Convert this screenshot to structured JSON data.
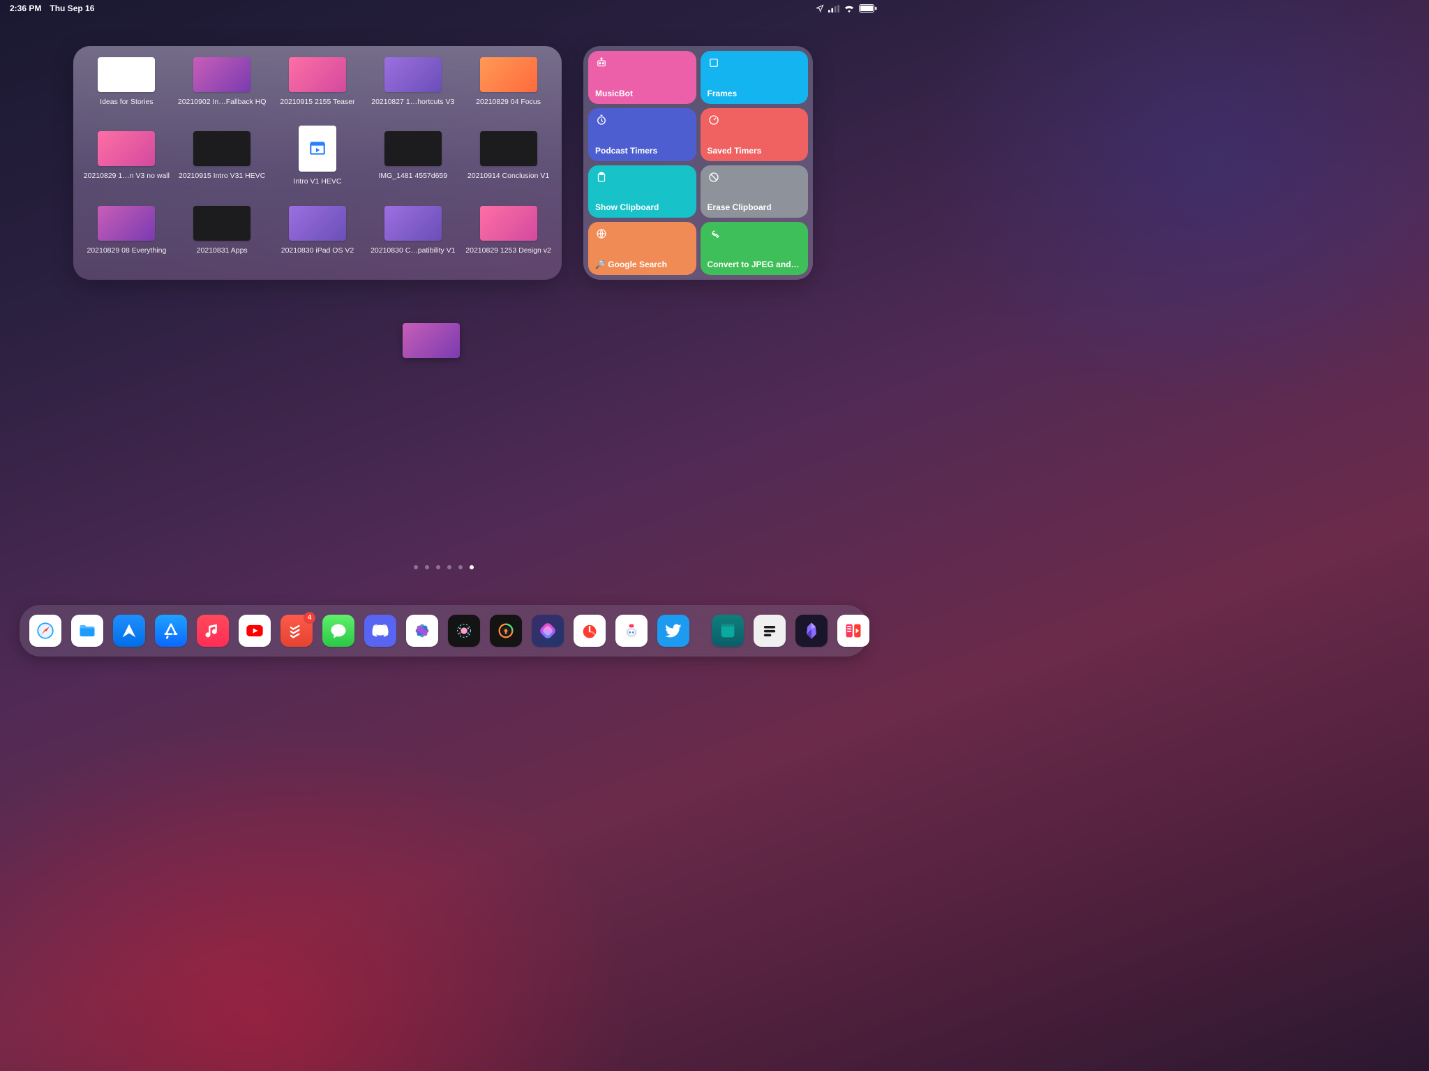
{
  "status": {
    "time": "2:36 PM",
    "date": "Thu Sep 16"
  },
  "files": [
    {
      "label": "Ideas for Stories",
      "theme": "ft-white"
    },
    {
      "label": "20210902 In…Fallback HQ",
      "theme": "ft-brand"
    },
    {
      "label": "20210915 2155 Teaser",
      "theme": "ft-pink"
    },
    {
      "label": "20210827 1…hortcuts V3",
      "theme": "ft-purple"
    },
    {
      "label": "20210829 04 Focus",
      "theme": "ft-amber"
    },
    {
      "label": "20210829 1…n V3 no wall",
      "theme": "ft-pink"
    },
    {
      "label": "20210915 Intro V31 HEVC",
      "theme": "ft-dark"
    },
    {
      "label": "Intro V1 HEVC",
      "theme": "ft-doc"
    },
    {
      "label": "IMG_1481 4557d659",
      "theme": "ft-dark"
    },
    {
      "label": "20210914 Conclusion V1",
      "theme": "ft-dark"
    },
    {
      "label": "20210829 08 Everything",
      "theme": "ft-brand"
    },
    {
      "label": "20210831 Apps",
      "theme": "ft-dark"
    },
    {
      "label": "20210830 iPad OS V2",
      "theme": "ft-purple"
    },
    {
      "label": "20210830 C…patibility V1",
      "theme": "ft-purple"
    },
    {
      "label": "20210829 1253 Design v2",
      "theme": "ft-pink"
    }
  ],
  "shortcuts": [
    {
      "label": "MusicBot",
      "icon": "robot",
      "color": "#ec5fa9"
    },
    {
      "label": "Frames",
      "icon": "square",
      "color": "#14b4f0"
    },
    {
      "label": "Podcast Timers",
      "icon": "clock",
      "color": "#4d5fd0"
    },
    {
      "label": "Saved Timers",
      "icon": "gauge",
      "color": "#f06262"
    },
    {
      "label": "Show Clipboard",
      "icon": "clipboard",
      "color": "#17c2c8"
    },
    {
      "label": "Erase Clipboard",
      "icon": "nope",
      "color": "#8e939b"
    },
    {
      "label": "🔎 Google Search",
      "icon": "globe",
      "color": "#f08b55"
    },
    {
      "label": "Convert to JPEG and C…",
      "icon": "wrench",
      "color": "#3fbf59"
    }
  ],
  "pagination": {
    "count": 6,
    "active": 5
  },
  "dock": {
    "pinned": [
      {
        "name": "safari",
        "class": "bg-safari"
      },
      {
        "name": "files",
        "class": "bg-files"
      },
      {
        "name": "spark",
        "class": "bg-spark"
      },
      {
        "name": "appstore",
        "class": "bg-appstore"
      },
      {
        "name": "music",
        "class": "bg-music"
      },
      {
        "name": "youtube",
        "class": "bg-youtube"
      },
      {
        "name": "todoist",
        "class": "bg-todoist",
        "badge": "4"
      },
      {
        "name": "messages",
        "class": "bg-messages"
      },
      {
        "name": "discord",
        "class": "bg-discord"
      },
      {
        "name": "photos",
        "class": "bg-photos"
      },
      {
        "name": "hue",
        "class": "bg-chatgpt"
      },
      {
        "name": "auth",
        "class": "bg-auth"
      },
      {
        "name": "shortcuts",
        "class": "bg-shortcuts"
      },
      {
        "name": "timer",
        "class": "bg-timer"
      },
      {
        "name": "bot",
        "class": "bg-bot"
      },
      {
        "name": "twitter",
        "class": "bg-twitter"
      }
    ],
    "recent": [
      {
        "name": "craft",
        "class": "bg-craft"
      },
      {
        "name": "drafts",
        "class": "bg-drafts"
      },
      {
        "name": "obsidian",
        "class": "bg-obsidian"
      },
      {
        "name": "split",
        "class": "bg-split"
      }
    ]
  }
}
